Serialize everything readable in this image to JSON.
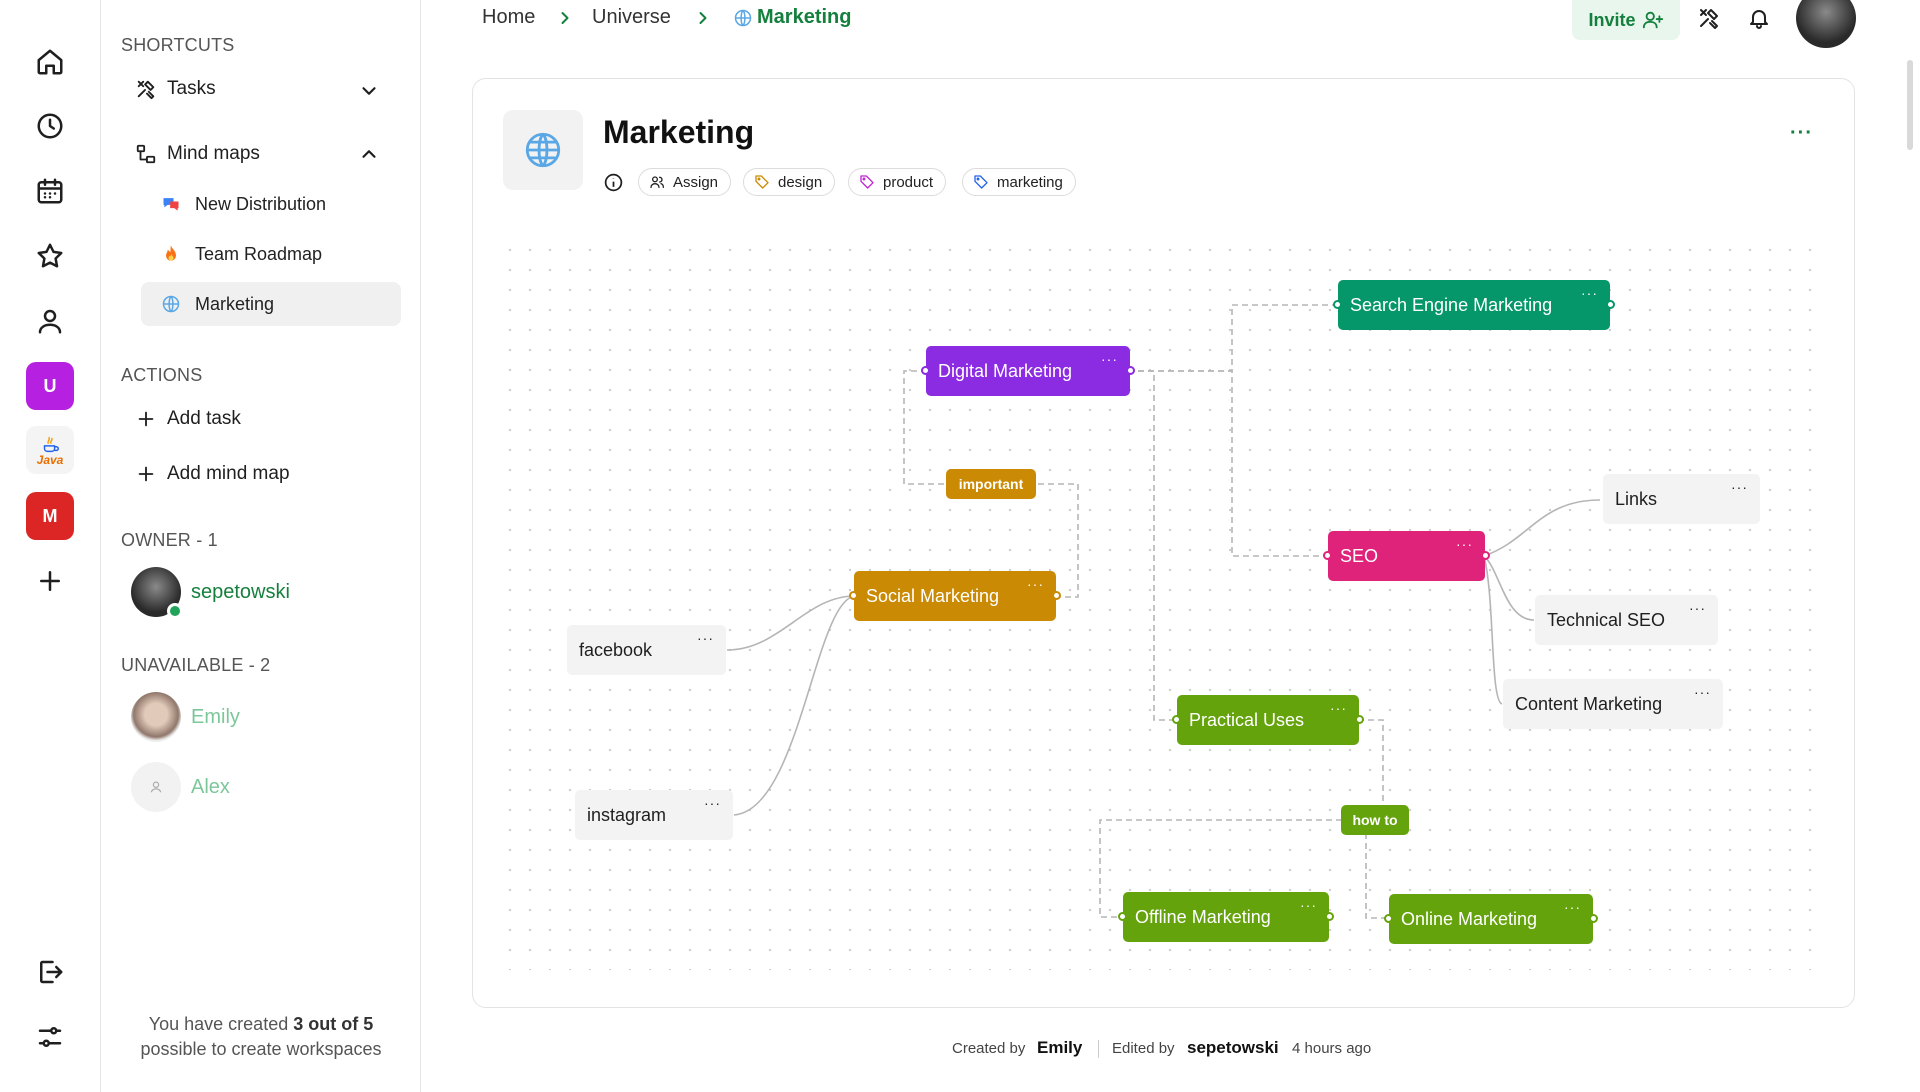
{
  "breadcrumb": {
    "home": "Home",
    "universe": "Universe",
    "current": "Marketing"
  },
  "topbar": {
    "invite_label": "Invite"
  },
  "sidebar": {
    "shortcuts_title": "SHORTCUTS",
    "tasks_label": "Tasks",
    "mindmaps_label": "Mind maps",
    "mindmaps": [
      {
        "label": "New Distribution",
        "icon": "chat-bubble-icon"
      },
      {
        "label": "Team Roadmap",
        "icon": "fire-icon"
      },
      {
        "label": "Marketing",
        "icon": "globe-icon"
      }
    ],
    "actions_title": "ACTIONS",
    "add_task": "Add task",
    "add_mindmap": "Add mind map",
    "owner_title": "OWNER - 1",
    "owner_name": "sepetowski",
    "unavailable_title": "UNAVAILABLE - 2",
    "unavailable": [
      "Emily",
      "Alex"
    ],
    "footer_pre": "You have created",
    "footer_bold": "3 out of 5",
    "footer_post": "possible to create workspaces"
  },
  "rail": {
    "workspaces": [
      {
        "letter": "U",
        "color": "#b620e0"
      },
      {
        "letter": "Java",
        "color": "#f59e0b"
      },
      {
        "letter": "M",
        "color": "#dc2626"
      }
    ]
  },
  "page": {
    "title": "Marketing",
    "assign_label": "Assign",
    "tags": [
      {
        "label": "design",
        "color": "#ca8a04"
      },
      {
        "label": "product",
        "color": "#c026d3"
      },
      {
        "label": "marketing",
        "color": "#2563eb"
      }
    ]
  },
  "mindmap": {
    "nodes": {
      "digital": "Digital Marketing",
      "sem": "Search Engine Marketing",
      "seo": "SEO",
      "links": "Links",
      "technical": "Technical SEO",
      "content": "Content Marketing",
      "social": "Social Marketing",
      "facebook": "facebook",
      "instagram": "instagram",
      "practical": "Practical Uses",
      "offline": "Offline Marketing",
      "online": "Online Marketing"
    },
    "edge_labels": {
      "important": "important",
      "howto": "how to"
    },
    "colors": {
      "purple": "#8b2be2",
      "green_dark": "#059669",
      "pink": "#e0237a",
      "orange": "#ca8a04",
      "lime": "#65a30d"
    }
  },
  "footer": {
    "created_by_label": "Created by",
    "created_by": "Emily",
    "edited_by_label": "Edited by",
    "edited_by": "sepetowski",
    "edited_time": "4 hours ago"
  }
}
